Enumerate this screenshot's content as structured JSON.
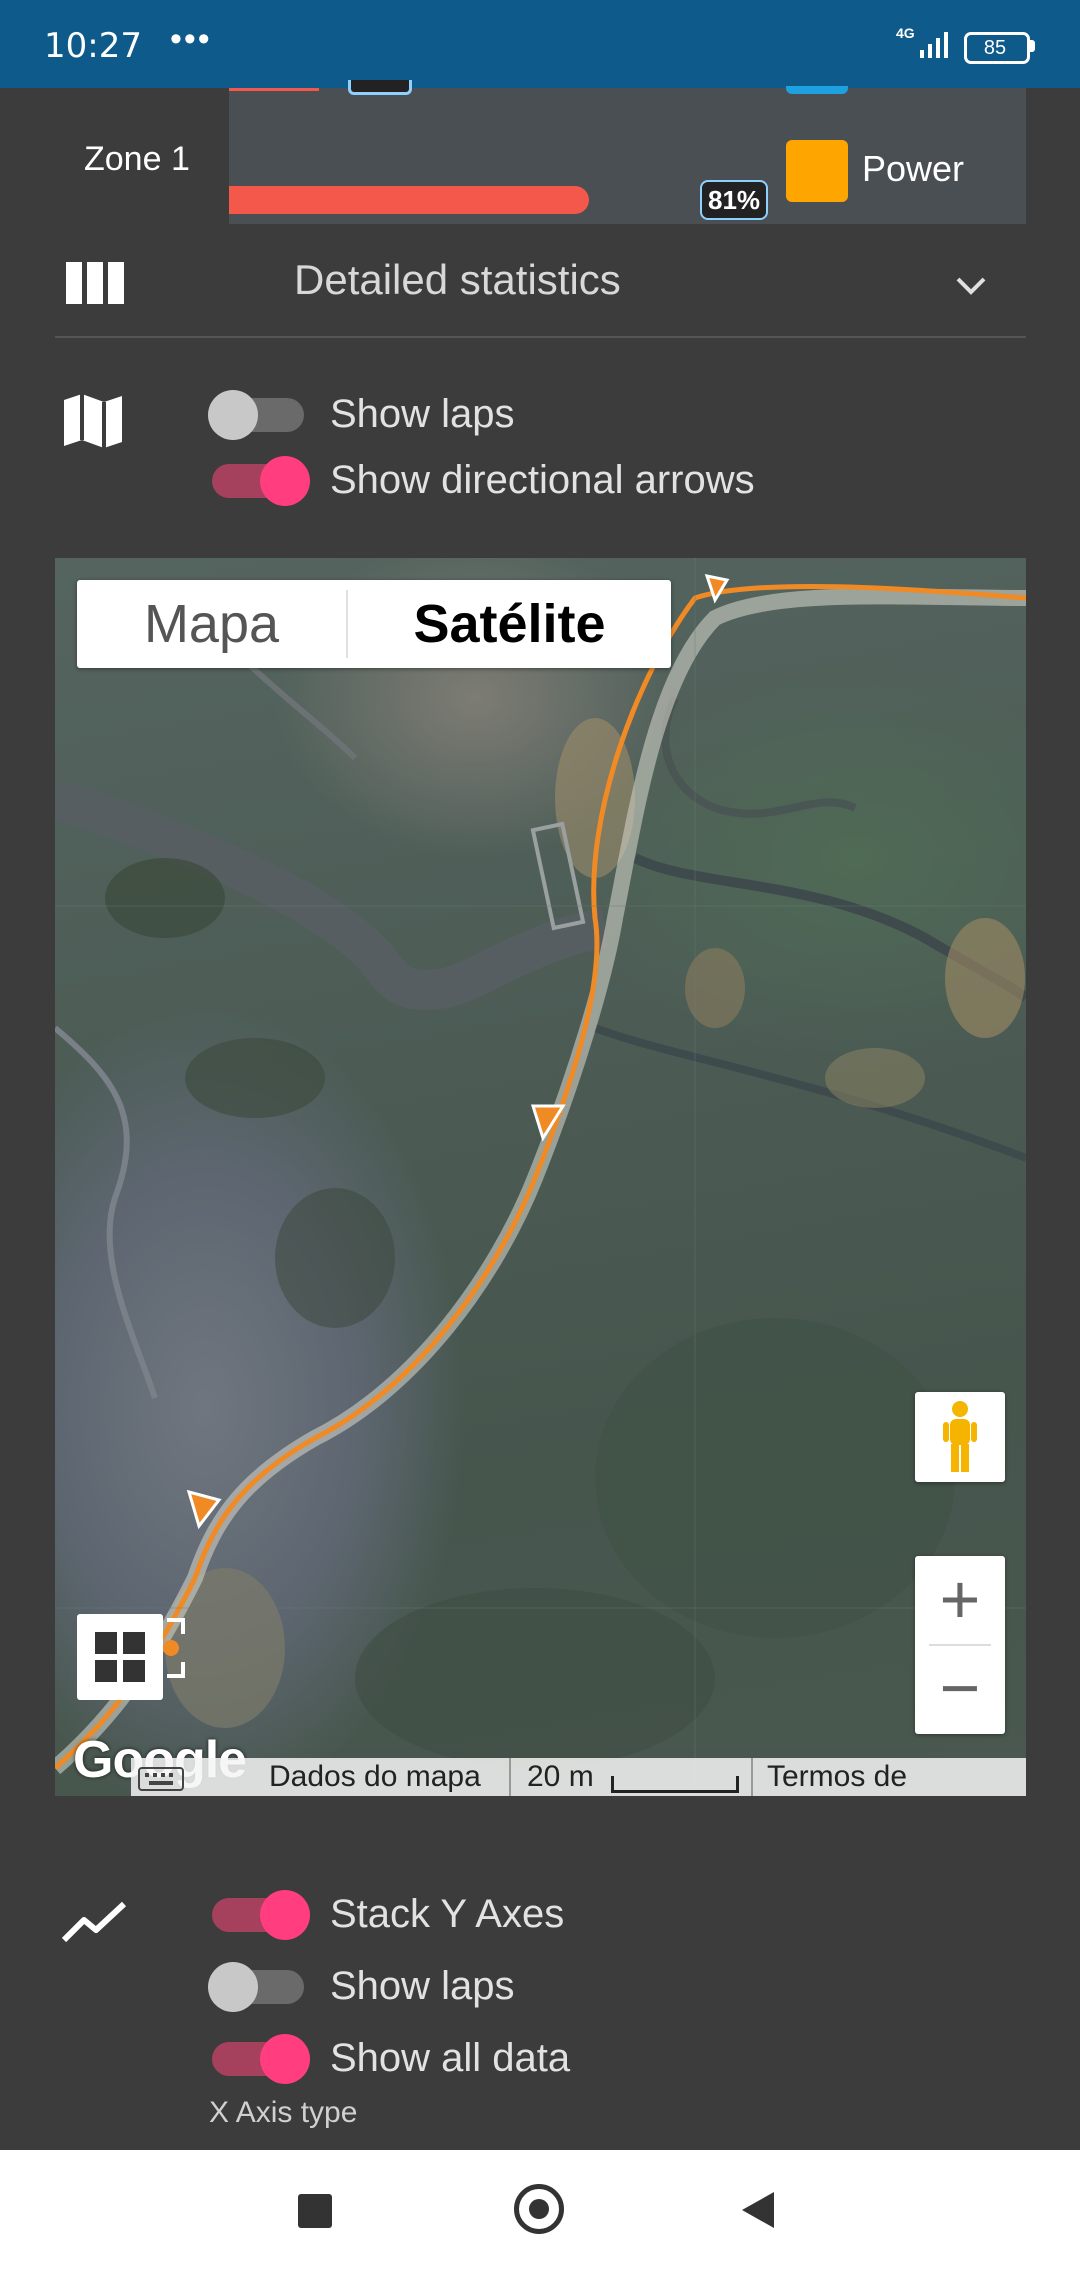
{
  "status_bar": {
    "time": "10:27",
    "dots": "•••",
    "network": "4G",
    "battery": "85",
    "background": "#0e5a8a"
  },
  "zone_panel": {
    "zone_label": "Zone 1",
    "percent_label": "81%",
    "percent": 81,
    "legend_label": "Power",
    "bar_color": "#f4584a",
    "legend_color": "#ffa500"
  },
  "stats": {
    "title": "Detailed statistics",
    "icon": "columns-icon",
    "chevron": "chevron-down-icon"
  },
  "map_options": {
    "icon": "map-icon",
    "toggles": [
      {
        "label": "Show laps",
        "on": false
      },
      {
        "label": "Show directional arrows",
        "on": true
      }
    ]
  },
  "map": {
    "tabs": [
      "Mapa",
      "Satélite"
    ],
    "selected_tab": "Satélite",
    "zoom_in": "+",
    "zoom_out": "−",
    "logo": "Google",
    "footer": {
      "data": "Dados do mapa",
      "scale": "20 m",
      "terms": "Termos de Utilização"
    },
    "route_color": "#f08a24"
  },
  "chart_options": {
    "icon": "line-chart-icon",
    "toggles": [
      {
        "label": "Stack Y Axes",
        "on": true
      },
      {
        "label": "Show laps",
        "on": false
      },
      {
        "label": "Show all data",
        "on": true
      }
    ],
    "x_axis_label": "X Axis type"
  },
  "toggle_colors": {
    "on": "#ff3d7f",
    "off": "#c8c8c8"
  }
}
